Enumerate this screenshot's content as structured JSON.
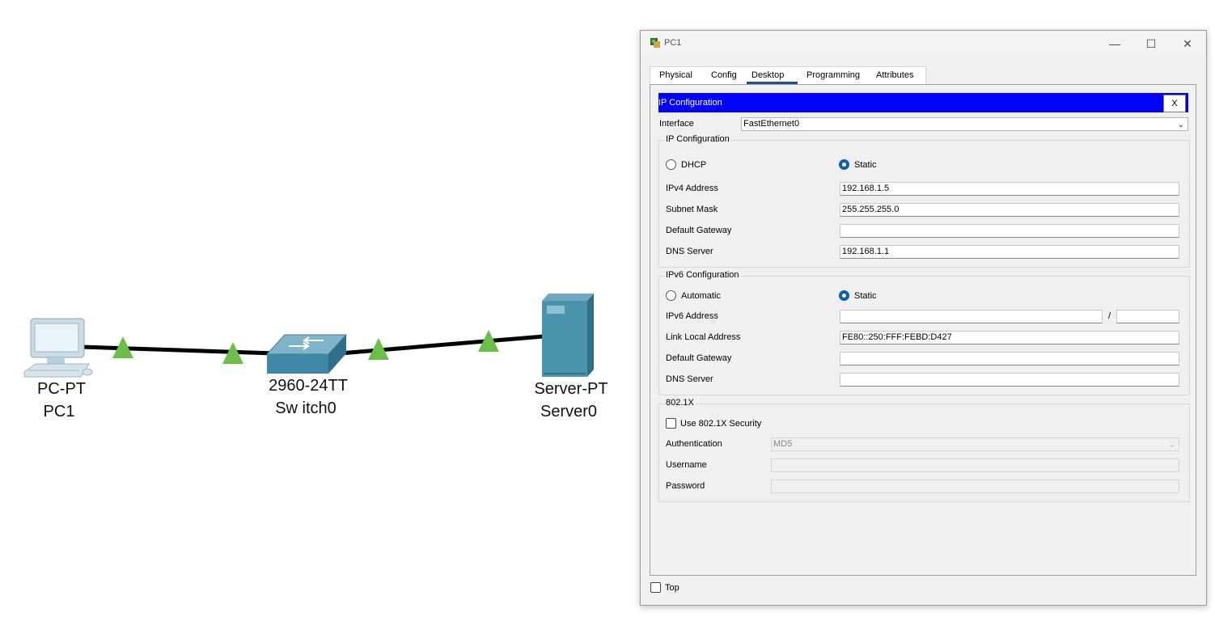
{
  "topology": {
    "devices": [
      {
        "model": "PC-PT",
        "name": "PC1"
      },
      {
        "model": "2960-24TT",
        "name": "Sw itch0"
      },
      {
        "model": "Server-PT",
        "name": "Server0"
      }
    ],
    "link_light_color": "#6abf45",
    "icon_names": [
      "pc-icon",
      "switch-icon",
      "server-icon"
    ]
  },
  "window": {
    "title": "PC1",
    "controls": {
      "minimize": "—",
      "maximize": "☐",
      "close": "✕"
    },
    "tabs": [
      "Physical",
      "Config",
      "Desktop",
      "Programming",
      "Attributes"
    ],
    "active_tab": "Desktop",
    "app": {
      "title": "IP Configuration",
      "close_label": "X",
      "interface_label": "Interface",
      "interface_value": "FastEthernet0",
      "ipv4": {
        "group_title": "IP Configuration",
        "dhcp_label": "DHCP",
        "static_label": "Static",
        "mode": "Static",
        "address_label": "IPv4 Address",
        "address_value": "192.168.1.5",
        "mask_label": "Subnet Mask",
        "mask_value": "255.255.255.0",
        "gateway_label": "Default Gateway",
        "gateway_value": "",
        "dns_label": "DNS Server",
        "dns_value": "192.168.1.1"
      },
      "ipv6": {
        "group_title": "IPv6 Configuration",
        "auto_label": "Automatic",
        "static_label": "Static",
        "mode": "Static",
        "address_label": "IPv6 Address",
        "address_value": "",
        "prefix_sep": "/",
        "prefix_value": "",
        "link_local_label": "Link Local Address",
        "link_local_value": "FE80::250:FFF:FEBD:D427",
        "gateway_label": "Default Gateway",
        "gateway_value": "",
        "dns_label": "DNS Server",
        "dns_value": ""
      },
      "dot1x": {
        "group_title": "802.1X",
        "use_label": "Use 802.1X Security",
        "use_checked": false,
        "auth_label": "Authentication",
        "auth_value": "MD5",
        "username_label": "Username",
        "username_value": "",
        "password_label": "Password",
        "password_value": ""
      }
    },
    "top_label": "Top",
    "top_checked": false
  },
  "colors": {
    "accent_bar": "#0000ff",
    "radio_selected": "#0a5fb8",
    "device_blue": "#4a93ad"
  }
}
